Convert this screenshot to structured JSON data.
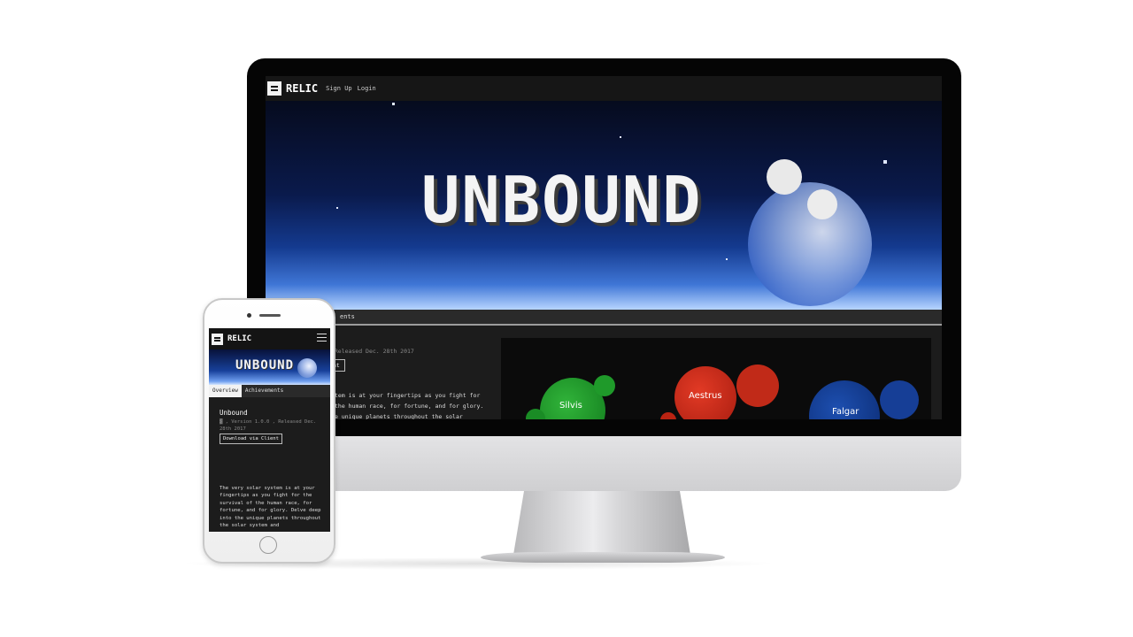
{
  "brand": {
    "name": "RELIC",
    "logo_icon": "relic-logo-icon"
  },
  "desktop": {
    "nav": {
      "sign_up": "Sign Up",
      "login": "Login"
    },
    "hero_title": "UNBOUND",
    "tabs": [
      "ents"
    ],
    "meta": ", Released Dec. 28th 2017",
    "download_button": "nt",
    "description": "tem is at your fingertips as you fight for the human race, for fortune, and for glory. e unique planets throughout the solar",
    "planets": [
      "Silvis",
      "Aestrus",
      "Falgar"
    ]
  },
  "mobile": {
    "menu_icon": "hamburger-icon",
    "hero_title": "UNBOUND",
    "tabs": [
      "Overview",
      "Achievements"
    ],
    "game_title": "Unbound",
    "meta": "▓ , Version 1.0.0 , Released Dec. 28th 2017",
    "download_button": "Download via Client",
    "description": "The very solar system is at your fingertips as you fight for the survival of the human race, for fortune, and for glory. Delve deep into the unique planets throughout the solar system and"
  },
  "colors": {
    "background": "#ffffff",
    "site_dark": "#1c1c1c",
    "nav_dark": "#161616",
    "accent_blue": "#143a8f"
  }
}
